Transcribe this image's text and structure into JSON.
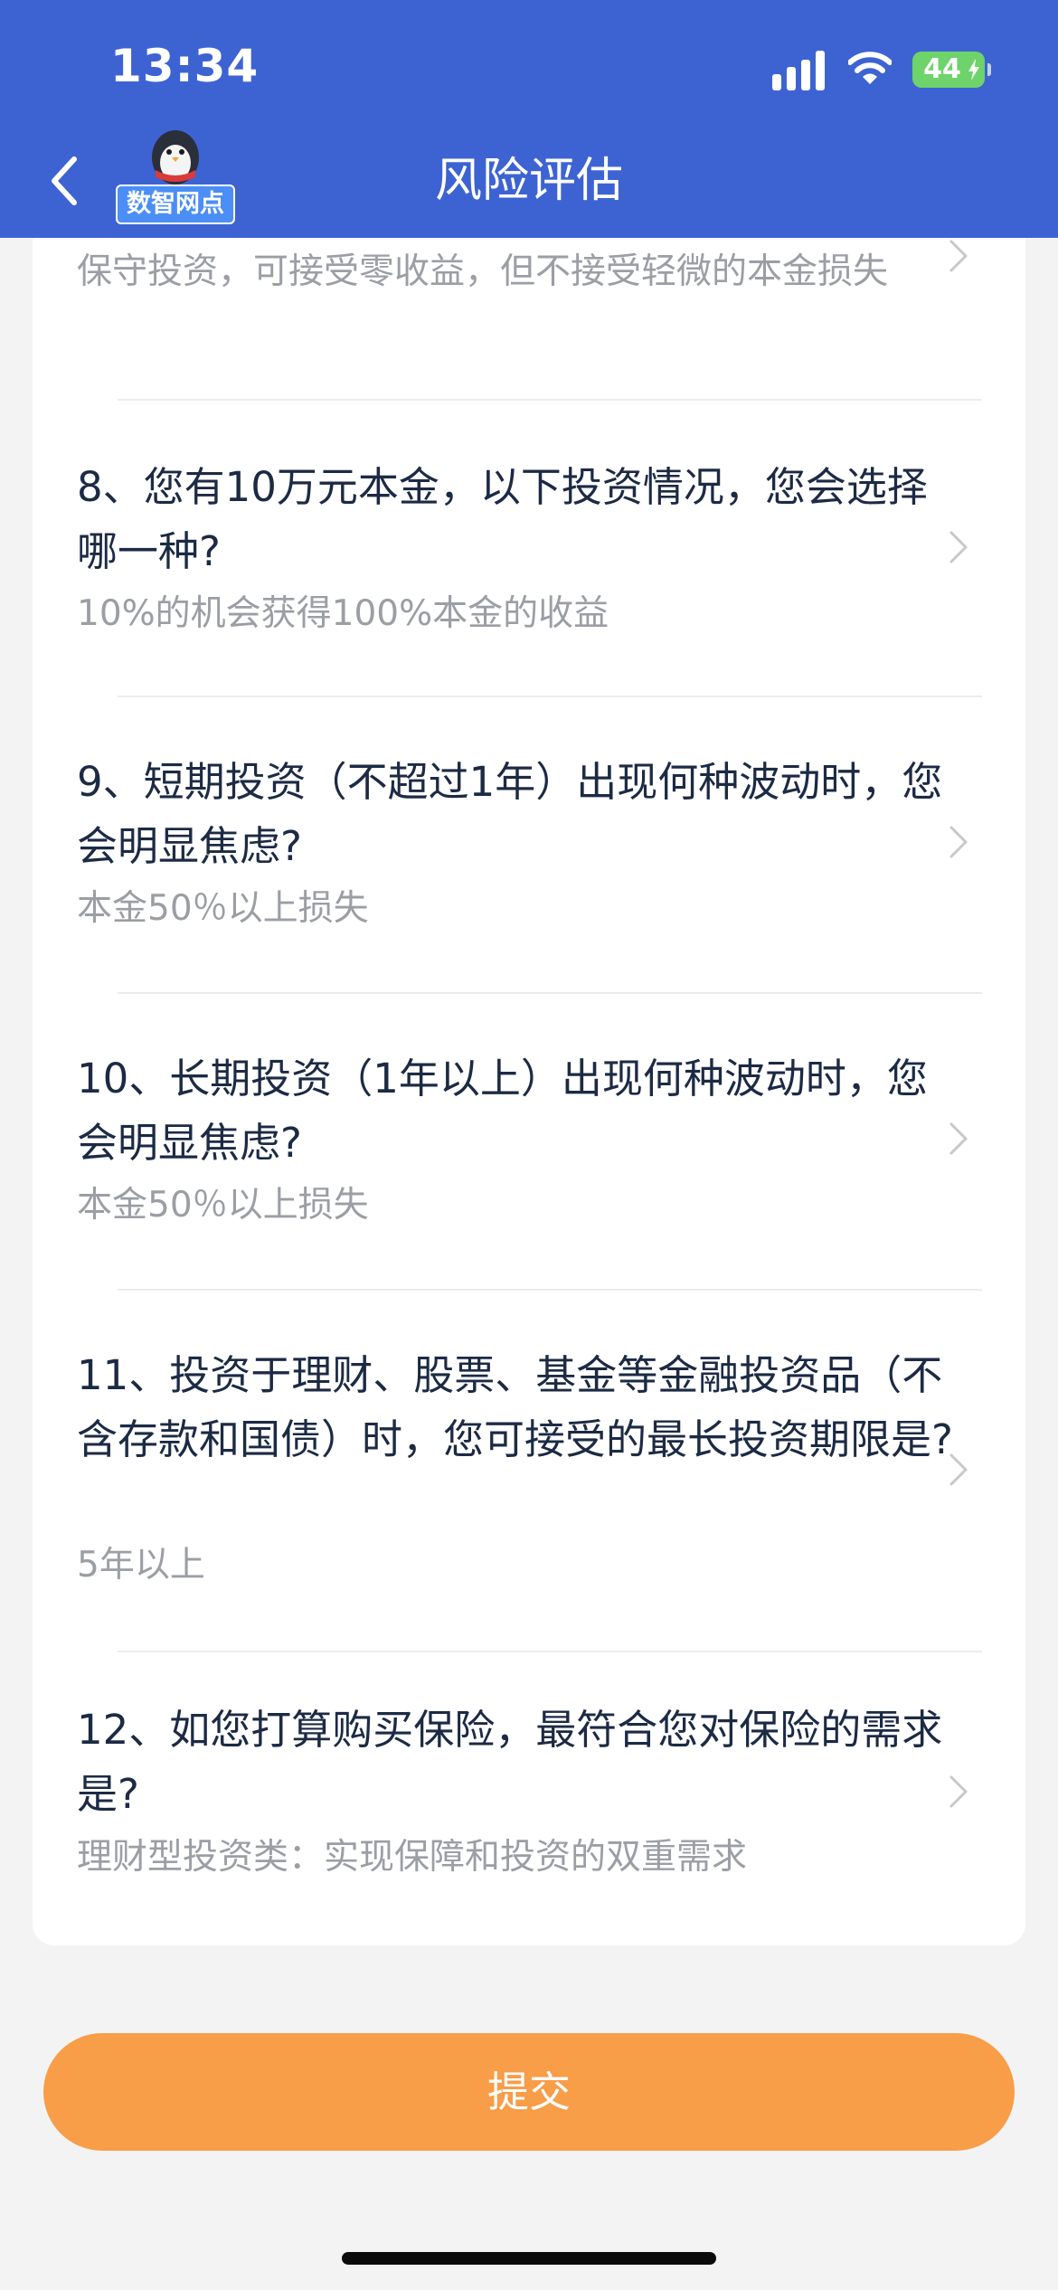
{
  "status_bar": {
    "time": "13:34",
    "battery_level": "44",
    "battery_color": "#6dd36a"
  },
  "header": {
    "title": "风险评估",
    "back_icon": "chevron-left-icon",
    "logo_text": "数智网点",
    "background_color": "#3d63d3"
  },
  "questions": [
    {
      "question": "",
      "answer": "保守投资，可接受零收益，但不接受轻微的本金损失"
    },
    {
      "question": "8、您有10万元本金，以下投资情况，您会选择哪一种?",
      "answer": "10%的机会获得100%本金的收益"
    },
    {
      "question": "9、短期投资（不超过1年）出现何种波动时，您会明显焦虑?",
      "answer": "本金50％以上损失"
    },
    {
      "question": "10、长期投资（1年以上）出现何种波动时，您会明显焦虑?",
      "answer": "本金50％以上损失"
    },
    {
      "question": "11、投资于理财、股票、基金等金融投资品（不含存款和国债）时，您可接受的最长投资期限是?",
      "answer": "5年以上"
    },
    {
      "question": "12、如您打算购买保险，最符合您对保险的需求是?",
      "answer": "理财型投资类：实现保障和投资的双重需求"
    }
  ],
  "submit": {
    "label": "提交",
    "color": "#f89d48"
  }
}
